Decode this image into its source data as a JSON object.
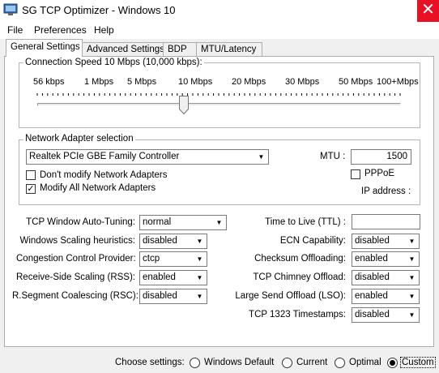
{
  "window": {
    "title": "SG TCP Optimizer - Windows 10",
    "close_glyph": "✕"
  },
  "menu": [
    "File",
    "Preferences",
    "Help"
  ],
  "tabs": [
    "General Settings",
    "Advanced Settings",
    "BDP",
    "MTU/Latency"
  ],
  "connection_speed": {
    "legend": "Connection Speed  10 Mbps (10,000 kbps):",
    "ticks": [
      "56 kbps",
      "1 Mbps",
      "5 Mbps",
      "10 Mbps",
      "20 Mbps",
      "30 Mbps",
      "50 Mbps",
      "100+Mbps"
    ],
    "selected_tick_index": 3
  },
  "adapter": {
    "legend": "Network Adapter selection",
    "selected": "Realtek PCIe GBE Family Controller",
    "mtu_label": "MTU :",
    "mtu_value": "1500",
    "pppoe_label": "PPPoE",
    "pppoe_checked": false,
    "dont_modify_label": "Don't modify Network Adapters",
    "dont_modify_checked": false,
    "modify_all_label": "Modify All Network Adapters",
    "modify_all_checked": true,
    "ip_label": "IP address :"
  },
  "settings_left": [
    {
      "label": "TCP Window Auto-Tuning:",
      "value": "normal"
    },
    {
      "label": "Windows Scaling heuristics:",
      "value": "disabled"
    },
    {
      "label": "Congestion Control Provider:",
      "value": "ctcp"
    },
    {
      "label": "Receive-Side Scaling (RSS):",
      "value": "enabled"
    },
    {
      "label": "R.Segment Coalescing (RSC):",
      "value": "disabled"
    }
  ],
  "settings_right": {
    "ttl_label": "Time to Live (TTL) :",
    "ttl_value": "",
    "rows": [
      {
        "label": "ECN Capability:",
        "value": "disabled"
      },
      {
        "label": "Checksum Offloading:",
        "value": "enabled"
      },
      {
        "label": "TCP Chimney Offload:",
        "value": "disabled"
      },
      {
        "label": "Large Send Offload (LSO):",
        "value": "enabled"
      },
      {
        "label": "TCP 1323 Timestamps:",
        "value": "disabled"
      }
    ]
  },
  "choose": {
    "label": "Choose settings:",
    "options": [
      "Windows Default",
      "Current",
      "Optimal",
      "Custom"
    ],
    "selected_index": 3
  },
  "combo_arrow": "▼",
  "check_glyph": "✓"
}
